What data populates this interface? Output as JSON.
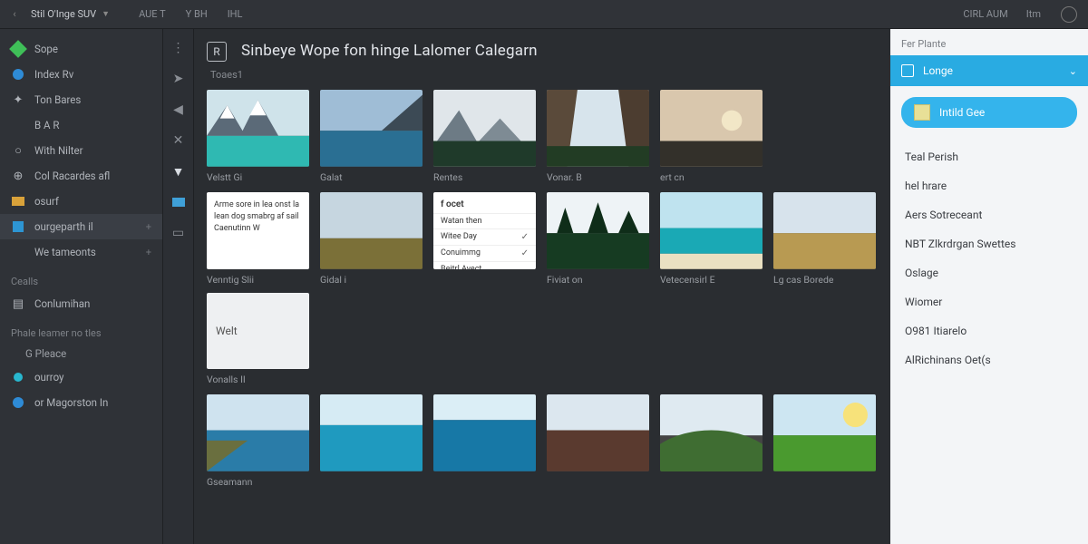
{
  "topbar": {
    "title": "Stil O'Inge SUV",
    "tabs": [
      "AUE T",
      "Y BH",
      "IHL"
    ],
    "right": [
      "CIRL AUM",
      "Itm"
    ]
  },
  "sidebar": {
    "items": [
      {
        "icon": "green-diamond",
        "label": "Sope"
      },
      {
        "icon": "blue-dot",
        "label": "Index Rv"
      },
      {
        "icon": "star",
        "label": "Ton Bares"
      },
      {
        "icon": "indent",
        "label": "B A R"
      },
      {
        "icon": "circle",
        "label": "With Nilter"
      },
      {
        "icon": "link",
        "label": "Col Racardes afl"
      },
      {
        "icon": "list-ico",
        "label": "osurf"
      },
      {
        "icon": "sq-ico",
        "label": "ourgeparth il",
        "trail": "+"
      },
      {
        "icon": "none",
        "label": "We tameonts",
        "trail": "+"
      }
    ],
    "section_a": "Cealls",
    "sub_a": "Conlumihan",
    "section_b": "Phale leamer no tles",
    "sub_b": "G Pleace",
    "dots": [
      {
        "icon": "cyan-dot",
        "label": "ourroy"
      },
      {
        "icon": "blue-dot",
        "label": "or Magorston In"
      }
    ]
  },
  "tools": [
    "dots",
    "arrow-r",
    "arrow-l",
    "x",
    "filter",
    "rect",
    "rect2"
  ],
  "heading": {
    "r": "R",
    "title": "Sinbeye Wope fon hinge Lalomer Calegarn",
    "sub": "Toaes1"
  },
  "grid": {
    "row1": [
      {
        "kind": "mtn-lake",
        "cap": "Velstt Gi"
      },
      {
        "kind": "lake-cliff",
        "cap": "Galat"
      },
      {
        "kind": "fog-mtn",
        "cap": "Rentes"
      },
      {
        "kind": "canyon",
        "cap": "Vonar. B"
      },
      {
        "kind": "sunset",
        "cap": "ert cn"
      }
    ],
    "row2": [
      {
        "kind": "text",
        "cap": "Venntig Slii",
        "lines": [
          "Arme sore in lea onst la",
          "lean dog smabrg af sail",
          "Caenutinn W"
        ]
      },
      {
        "kind": "plain",
        "cap": "Gidal i"
      },
      {
        "kind": "list",
        "cap": "",
        "header": "f ocet",
        "items": [
          "Watan then",
          "Witee Day",
          "Conuimmg",
          "Beitrl Avect"
        ],
        "checks": [
          false,
          true,
          true,
          false
        ]
      },
      {
        "kind": "forest",
        "cap": "Fiviat on"
      },
      {
        "kind": "beach",
        "cap": "Vetecensirl E"
      },
      {
        "kind": "field",
        "cap": "Lg cas Borede"
      }
    ],
    "row2b_input": "Welt",
    "row3": [
      {
        "kind": "coast",
        "cap": "Gseamann"
      },
      {
        "kind": "sea",
        "cap": ""
      },
      {
        "kind": "ocean",
        "cap": ""
      },
      {
        "kind": "dirt",
        "cap": ""
      },
      {
        "kind": "hill",
        "cap": ""
      },
      {
        "kind": "sunny",
        "cap": ""
      }
    ]
  },
  "inspector": {
    "top": "Fer Plante",
    "selected": "Longe",
    "pill": "Intild Gee",
    "items": [
      "Teal Perish",
      "hel hrare",
      "Aers Sotreceant",
      "NBT Zlkrdrgan Swettes",
      "Oslage",
      "Wiomer",
      "O981 Itiarelo",
      "AlRichinans Oet(s"
    ]
  }
}
